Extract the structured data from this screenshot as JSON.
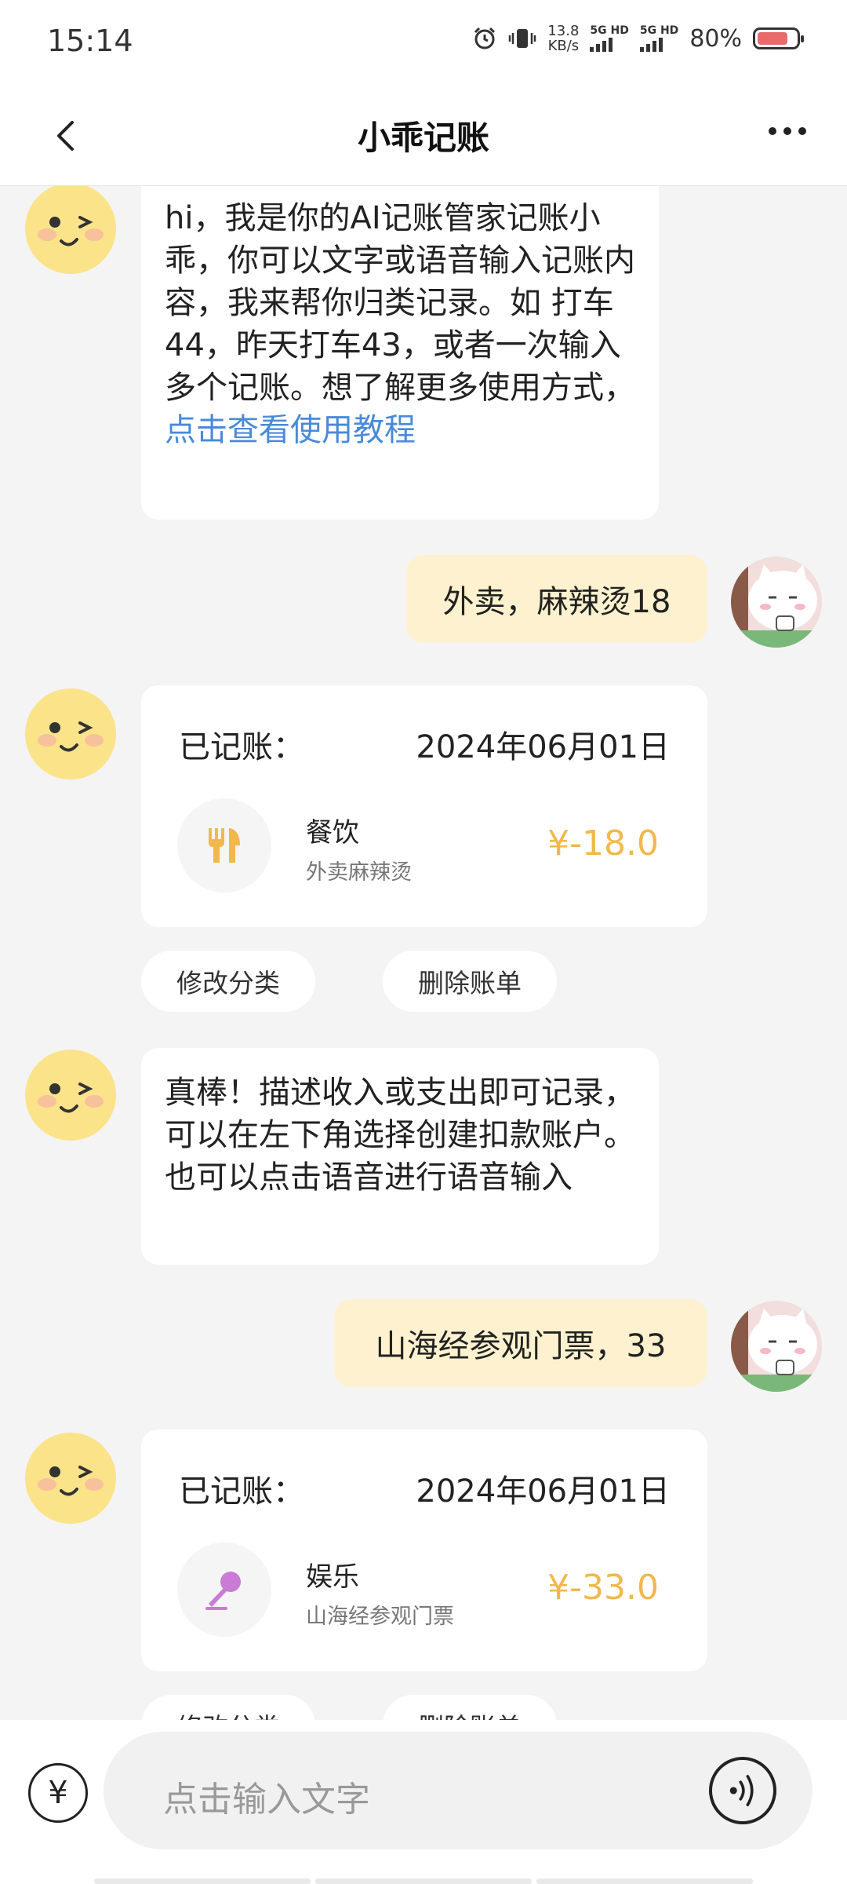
{
  "status": {
    "time": "15:14",
    "speed_top": "13.8",
    "speed_bottom": "KB/s",
    "net1": "5G HD",
    "net2": "5G HD",
    "battery": "80%",
    "battery_level": 0.8
  },
  "header": {
    "title": "小乖记账"
  },
  "messages": {
    "bot_intro": {
      "text": "hi，我是你的AI记账管家记账小乖，你可以文字或语音输入记账内容，我来帮你归类记录。如 打车44，昨天打车43，或者一次输入多个记账。想了解更多使用方式，",
      "link": "点击查看使用教程"
    },
    "user_1": "外卖，麻辣烫18",
    "record_1": {
      "label": "已记账：",
      "date": "2024年06月01日",
      "category": "餐饮",
      "note": "外卖麻辣烫",
      "amount": "¥-18.0",
      "icon": "fork-knife-icon"
    },
    "actions_1": {
      "edit": "修改分类",
      "delete": "删除账单"
    },
    "bot_tip": "真棒！描述收入或支出即可记录，可以在左下角选择创建扣款账户。也可以点击语音进行语音输入",
    "user_2": "山海经参观门票，33",
    "record_2": {
      "label": "已记账：",
      "date": "2024年06月01日",
      "category": "娱乐",
      "note": "山海经参观门票",
      "amount": "¥-33.0",
      "icon": "microphone-icon"
    },
    "actions_2": {
      "edit": "修改分类",
      "delete": "删除账单"
    }
  },
  "input": {
    "account_symbol": "¥",
    "placeholder": "点击输入文字"
  },
  "colors": {
    "amount": "#f3b84b",
    "link": "#4a8ad8",
    "user_bubble": "#fdf1cf"
  }
}
